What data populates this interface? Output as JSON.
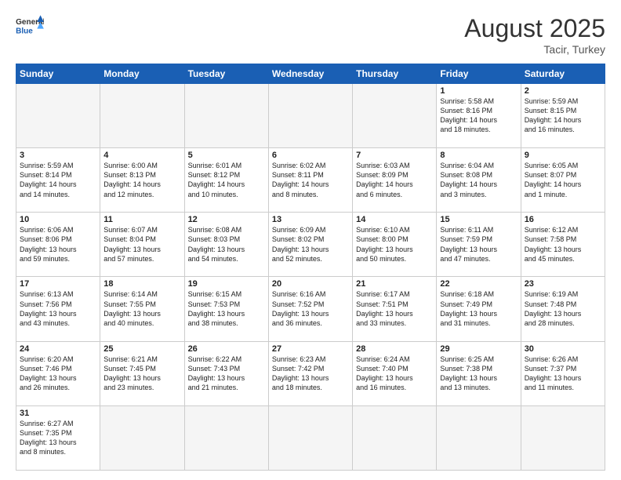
{
  "header": {
    "logo_general": "General",
    "logo_blue": "Blue",
    "month_title": "August 2025",
    "location": "Tacir, Turkey"
  },
  "weekdays": [
    "Sunday",
    "Monday",
    "Tuesday",
    "Wednesday",
    "Thursday",
    "Friday",
    "Saturday"
  ],
  "weeks": [
    [
      {
        "day": "",
        "info": ""
      },
      {
        "day": "",
        "info": ""
      },
      {
        "day": "",
        "info": ""
      },
      {
        "day": "",
        "info": ""
      },
      {
        "day": "",
        "info": ""
      },
      {
        "day": "1",
        "info": "Sunrise: 5:58 AM\nSunset: 8:16 PM\nDaylight: 14 hours\nand 18 minutes."
      },
      {
        "day": "2",
        "info": "Sunrise: 5:59 AM\nSunset: 8:15 PM\nDaylight: 14 hours\nand 16 minutes."
      }
    ],
    [
      {
        "day": "3",
        "info": "Sunrise: 5:59 AM\nSunset: 8:14 PM\nDaylight: 14 hours\nand 14 minutes."
      },
      {
        "day": "4",
        "info": "Sunrise: 6:00 AM\nSunset: 8:13 PM\nDaylight: 14 hours\nand 12 minutes."
      },
      {
        "day": "5",
        "info": "Sunrise: 6:01 AM\nSunset: 8:12 PM\nDaylight: 14 hours\nand 10 minutes."
      },
      {
        "day": "6",
        "info": "Sunrise: 6:02 AM\nSunset: 8:11 PM\nDaylight: 14 hours\nand 8 minutes."
      },
      {
        "day": "7",
        "info": "Sunrise: 6:03 AM\nSunset: 8:09 PM\nDaylight: 14 hours\nand 6 minutes."
      },
      {
        "day": "8",
        "info": "Sunrise: 6:04 AM\nSunset: 8:08 PM\nDaylight: 14 hours\nand 3 minutes."
      },
      {
        "day": "9",
        "info": "Sunrise: 6:05 AM\nSunset: 8:07 PM\nDaylight: 14 hours\nand 1 minute."
      }
    ],
    [
      {
        "day": "10",
        "info": "Sunrise: 6:06 AM\nSunset: 8:06 PM\nDaylight: 13 hours\nand 59 minutes."
      },
      {
        "day": "11",
        "info": "Sunrise: 6:07 AM\nSunset: 8:04 PM\nDaylight: 13 hours\nand 57 minutes."
      },
      {
        "day": "12",
        "info": "Sunrise: 6:08 AM\nSunset: 8:03 PM\nDaylight: 13 hours\nand 54 minutes."
      },
      {
        "day": "13",
        "info": "Sunrise: 6:09 AM\nSunset: 8:02 PM\nDaylight: 13 hours\nand 52 minutes."
      },
      {
        "day": "14",
        "info": "Sunrise: 6:10 AM\nSunset: 8:00 PM\nDaylight: 13 hours\nand 50 minutes."
      },
      {
        "day": "15",
        "info": "Sunrise: 6:11 AM\nSunset: 7:59 PM\nDaylight: 13 hours\nand 47 minutes."
      },
      {
        "day": "16",
        "info": "Sunrise: 6:12 AM\nSunset: 7:58 PM\nDaylight: 13 hours\nand 45 minutes."
      }
    ],
    [
      {
        "day": "17",
        "info": "Sunrise: 6:13 AM\nSunset: 7:56 PM\nDaylight: 13 hours\nand 43 minutes."
      },
      {
        "day": "18",
        "info": "Sunrise: 6:14 AM\nSunset: 7:55 PM\nDaylight: 13 hours\nand 40 minutes."
      },
      {
        "day": "19",
        "info": "Sunrise: 6:15 AM\nSunset: 7:53 PM\nDaylight: 13 hours\nand 38 minutes."
      },
      {
        "day": "20",
        "info": "Sunrise: 6:16 AM\nSunset: 7:52 PM\nDaylight: 13 hours\nand 36 minutes."
      },
      {
        "day": "21",
        "info": "Sunrise: 6:17 AM\nSunset: 7:51 PM\nDaylight: 13 hours\nand 33 minutes."
      },
      {
        "day": "22",
        "info": "Sunrise: 6:18 AM\nSunset: 7:49 PM\nDaylight: 13 hours\nand 31 minutes."
      },
      {
        "day": "23",
        "info": "Sunrise: 6:19 AM\nSunset: 7:48 PM\nDaylight: 13 hours\nand 28 minutes."
      }
    ],
    [
      {
        "day": "24",
        "info": "Sunrise: 6:20 AM\nSunset: 7:46 PM\nDaylight: 13 hours\nand 26 minutes."
      },
      {
        "day": "25",
        "info": "Sunrise: 6:21 AM\nSunset: 7:45 PM\nDaylight: 13 hours\nand 23 minutes."
      },
      {
        "day": "26",
        "info": "Sunrise: 6:22 AM\nSunset: 7:43 PM\nDaylight: 13 hours\nand 21 minutes."
      },
      {
        "day": "27",
        "info": "Sunrise: 6:23 AM\nSunset: 7:42 PM\nDaylight: 13 hours\nand 18 minutes."
      },
      {
        "day": "28",
        "info": "Sunrise: 6:24 AM\nSunset: 7:40 PM\nDaylight: 13 hours\nand 16 minutes."
      },
      {
        "day": "29",
        "info": "Sunrise: 6:25 AM\nSunset: 7:38 PM\nDaylight: 13 hours\nand 13 minutes."
      },
      {
        "day": "30",
        "info": "Sunrise: 6:26 AM\nSunset: 7:37 PM\nDaylight: 13 hours\nand 11 minutes."
      }
    ],
    [
      {
        "day": "31",
        "info": "Sunrise: 6:27 AM\nSunset: 7:35 PM\nDaylight: 13 hours\nand 8 minutes."
      },
      {
        "day": "",
        "info": ""
      },
      {
        "day": "",
        "info": ""
      },
      {
        "day": "",
        "info": ""
      },
      {
        "day": "",
        "info": ""
      },
      {
        "day": "",
        "info": ""
      },
      {
        "day": "",
        "info": ""
      }
    ]
  ]
}
